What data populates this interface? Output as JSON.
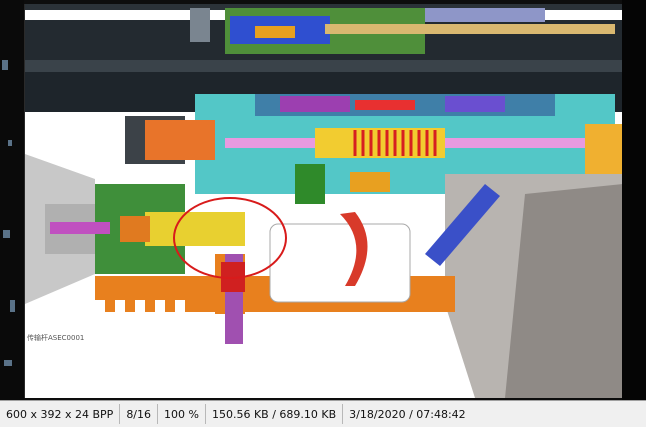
{
  "drawing": {
    "part_label": "传输杆ASEC0001"
  },
  "statusbar": {
    "image_info": "600 x 392 x 24 BPP",
    "page": "8/16",
    "zoom": "100 %",
    "file_size": "150.56 KB / 689.10 KB",
    "datetime": "3/18/2020 / 07:48:42"
  },
  "annotation": {
    "circle_color": "#d81b1b"
  }
}
